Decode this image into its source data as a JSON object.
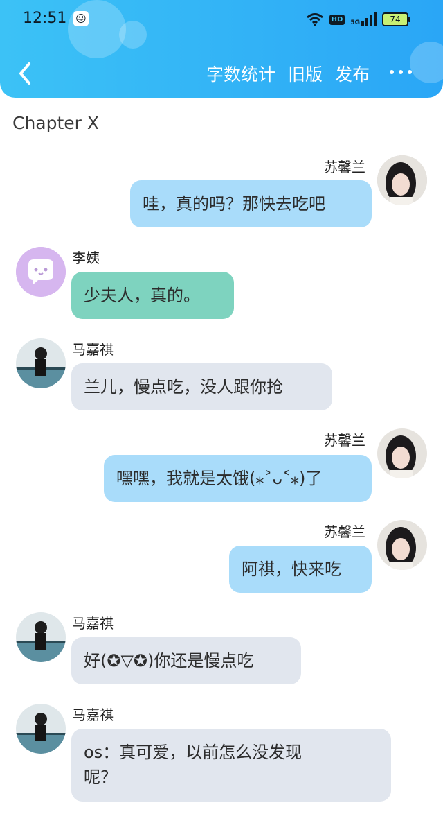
{
  "status_bar": {
    "time": "12:51",
    "battery": "74",
    "network": "5G"
  },
  "toolbar": {
    "word_count": "字数统计",
    "old_version": "旧版",
    "publish": "发布"
  },
  "chapter_title": "Chapter X",
  "messages": [
    {
      "side": "right",
      "name": "苏馨兰",
      "text": "哇，真的吗？那快去吃吧"
    },
    {
      "side": "left",
      "name": "李姨",
      "text": "少夫人，真的。"
    },
    {
      "side": "left",
      "name": "马嘉祺",
      "text": "兰儿，慢点吃，没人跟你抢"
    },
    {
      "side": "right",
      "name": "苏馨兰",
      "text": "嘿嘿，我就是太饿(⁎˃ᴗ˂⁎)了"
    },
    {
      "side": "right",
      "name": "苏馨兰",
      "text": "阿祺，快来吃"
    },
    {
      "side": "left",
      "name": "马嘉祺",
      "text": "好(✪▽✪)你还是慢点吃"
    },
    {
      "side": "left",
      "name": "马嘉祺",
      "text_line1": "os：真可爱，以前怎么没发现",
      "text_line2": "呢？"
    }
  ],
  "colors": {
    "header": "#2aa6f6",
    "right_bubble": "#a9dcfa",
    "left_bubble": "#e1e6ee",
    "teal_bubble": "#7ed3bf"
  }
}
